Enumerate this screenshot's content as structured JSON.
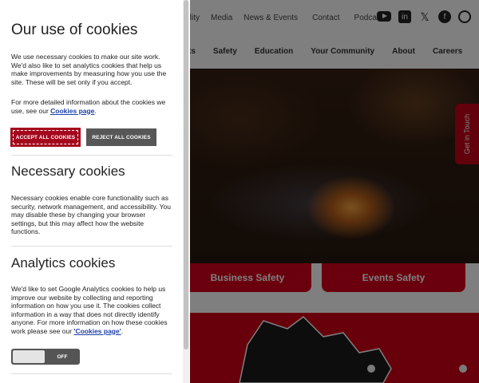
{
  "site": {
    "topbar_links": [
      "bility",
      "Media",
      "News & Events",
      "Contact",
      "Podcast"
    ],
    "social_icons": [
      "youtube-icon",
      "linkedin-icon",
      "x-icon",
      "facebook-icon",
      "instagram-icon"
    ],
    "main_nav": [
      "ts",
      "Safety",
      "Education",
      "Your Community",
      "About",
      "Careers"
    ],
    "get_in_touch": "Get in Touch",
    "hero_buttons": [
      "Business Safety",
      "Events Safety"
    ]
  },
  "cookie_panel": {
    "title": "Our use of cookies",
    "intro": "We use necessary cookies to make our site work. We'd also like to set analytics cookies that help us make improvements by measuring how you use the site. These will be set only if you accept.",
    "more_info_prefix": "For more detailed information about the cookies we use, see our ",
    "more_info_link": "Cookies page",
    "more_info_suffix": ".",
    "accept_label": "ACCEPT ALL COOKIES",
    "reject_label": "REJECT ALL COOKIES",
    "necessary_title": "Necessary cookies",
    "necessary_text": "Necessary cookies enable core functionality such as security, network management, and accessibility. You may disable these by changing your browser settings, but this may affect how the website functions.",
    "analytics_title": "Analytics cookies",
    "analytics_text": "We'd like to set Google Analytics cookies to help us improve our website by collecting and reporting information on how you use it. The cookies collect information in a way that does not directly identify anyone. For more information on how these cookies work please see our ",
    "analytics_link": "'Cookies page'",
    "analytics_suffix": ".",
    "toggle_state": "OFF"
  },
  "colors": {
    "brand_red": "#cf0015",
    "accept_red": "#a5071c",
    "reject_grey": "#575757",
    "link_blue": "#1b3ea8"
  }
}
